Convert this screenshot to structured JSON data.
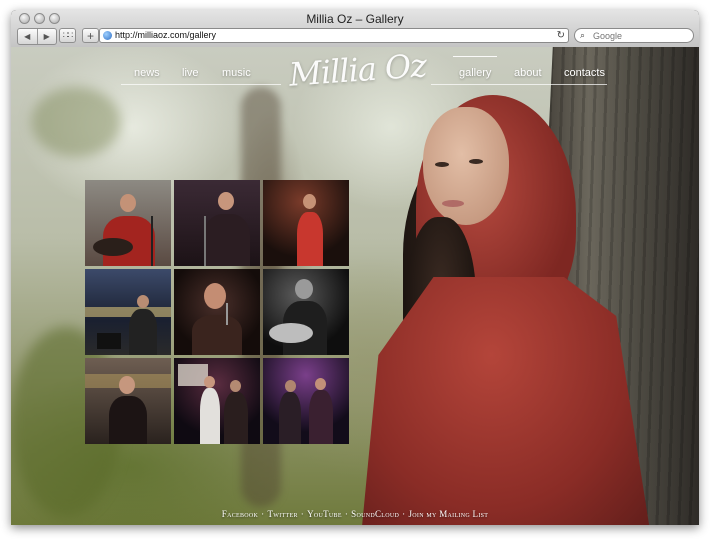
{
  "window": {
    "title": "Millia Oz – Gallery"
  },
  "toolbar": {
    "back_icon": "◀",
    "forward_icon": "▶",
    "url": "http://milliaoz.com/gallery",
    "search_placeholder": "Google"
  },
  "site": {
    "logo": "Millia Oz",
    "nav_left": [
      "news",
      "live",
      "music"
    ],
    "nav_right": [
      "gallery",
      "about",
      "contacts"
    ],
    "active": "gallery"
  },
  "gallery": {
    "thumbnails": [
      {
        "desc": "singer-guitar-red"
      },
      {
        "desc": "singer-mic-dark"
      },
      {
        "desc": "singer-stage-red-dress"
      },
      {
        "desc": "guitarist-street-night"
      },
      {
        "desc": "singer-close-mic"
      },
      {
        "desc": "guitarist-monochrome"
      },
      {
        "desc": "singer-street-evening"
      },
      {
        "desc": "duo-stage"
      },
      {
        "desc": "band-bar"
      }
    ]
  },
  "footer": {
    "links": [
      "Facebook",
      "Twitter",
      "YouTube",
      "SoundCloud",
      "Join my Mailing List"
    ],
    "separator": "·"
  }
}
